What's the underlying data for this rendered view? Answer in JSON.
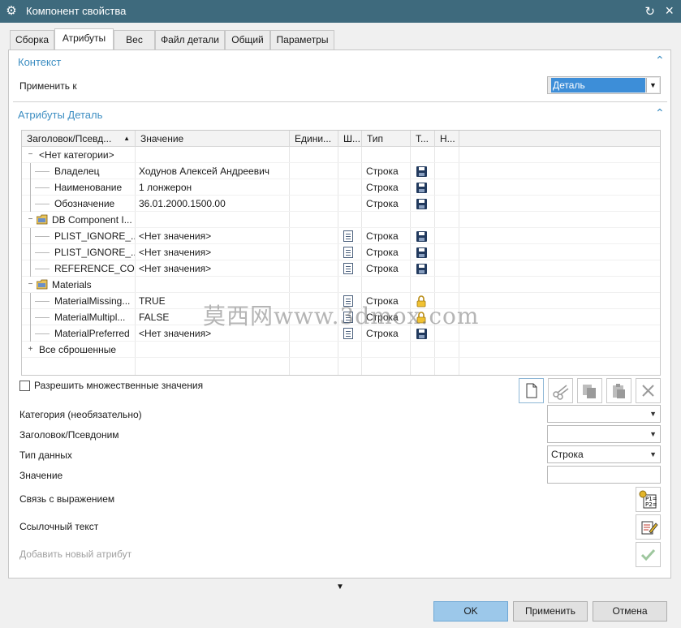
{
  "window": {
    "title": "Компонент свойства"
  },
  "tabs": [
    {
      "label": "Сборка"
    },
    {
      "label": "Атрибуты"
    },
    {
      "label": "Вес"
    },
    {
      "label": "Файл детали"
    },
    {
      "label": "Общий"
    },
    {
      "label": "Параметры"
    }
  ],
  "active_tab": "Атрибуты",
  "context": {
    "title": "Контекст",
    "apply_label": "Применить к",
    "apply_value": "Деталь"
  },
  "attributes": {
    "title": "Атрибуты Деталь",
    "columns": [
      "Заголовок/Псевд...",
      "Значение",
      "Едини...",
      "Ш...",
      "Тип",
      "Т...",
      "Н..."
    ],
    "rows": [
      {
        "title": "<Нет категории>",
        "value": "",
        "type": "",
        "kind": "category",
        "expand": "−",
        "icon": "none",
        "value_icon": false,
        "t_icon": "none",
        "depth": 0
      },
      {
        "title": "Владелец",
        "value": "Ходунов Алексей Андреевич",
        "type": "Строка",
        "kind": "item",
        "value_icon": false,
        "t_icon": "save-icon",
        "depth": 1
      },
      {
        "title": "Наименование",
        "value": "1 лонжерон",
        "type": "Строка",
        "kind": "item",
        "value_icon": false,
        "t_icon": "save-icon",
        "depth": 1
      },
      {
        "title": "Обозначение",
        "value": "36.01.2000.1500.00",
        "type": "Строка",
        "kind": "item",
        "value_icon": false,
        "t_icon": "save-icon",
        "depth": 1
      },
      {
        "title": "DB Component I...",
        "value": "",
        "type": "",
        "kind": "category",
        "expand": "−",
        "icon": "folder-icon",
        "value_icon": false,
        "t_icon": "none",
        "depth": 0
      },
      {
        "title": "PLIST_IGNORE_...",
        "value": "<Нет значения>",
        "type": "Строка",
        "kind": "item",
        "value_icon": true,
        "t_icon": "save-icon",
        "depth": 1
      },
      {
        "title": "PLIST_IGNORE_...",
        "value": "<Нет значения>",
        "type": "Строка",
        "kind": "item",
        "value_icon": true,
        "t_icon": "save-icon",
        "depth": 1
      },
      {
        "title": "REFERENCE_CO...",
        "value": "<Нет значения>",
        "type": "Строка",
        "kind": "item",
        "value_icon": true,
        "t_icon": "save-icon",
        "depth": 1
      },
      {
        "title": "Materials",
        "value": "",
        "type": "",
        "kind": "category",
        "expand": "−",
        "icon": "folder-icon",
        "value_icon": false,
        "t_icon": "none",
        "depth": 0
      },
      {
        "title": "MaterialMissing...",
        "value": "TRUE",
        "type": "Строка",
        "kind": "item",
        "value_icon": true,
        "t_icon": "lock-icon",
        "depth": 1
      },
      {
        "title": "MaterialMultipl...",
        "value": "FALSE",
        "type": "Строка",
        "kind": "item",
        "value_icon": true,
        "t_icon": "lock-icon",
        "depth": 1
      },
      {
        "title": "MaterialPreferred",
        "value": "<Нет значения>",
        "type": "Строка",
        "kind": "item",
        "value_icon": true,
        "t_icon": "save-icon",
        "depth": 1
      },
      {
        "title": "Все сброшенные",
        "value": "",
        "type": "",
        "kind": "category",
        "expand": "+",
        "icon": "none",
        "value_icon": false,
        "t_icon": "none",
        "depth": 0
      }
    ]
  },
  "multi": {
    "label": "Разрешить множественные значения",
    "checked": false
  },
  "form": {
    "category_label": "Категория (необязательно)",
    "category_value": "",
    "title_label": "Заголовок/Псевдоним",
    "title_value": "",
    "datatype_label": "Тип данных",
    "datatype_value": "Строка",
    "value_label": "Значение",
    "value_value": "",
    "expression_label": "Связь с выражением",
    "reftext_label": "Ссылочный текст",
    "add_label": "Добавить новый атрибут"
  },
  "buttons": {
    "ok": "OK",
    "apply": "Применить",
    "cancel": "Отмена"
  },
  "watermark": "莫西网www.3dmox.com",
  "colors": {
    "titlebar": "#3e6a7d",
    "accent": "#3d8ec2",
    "ok_button": "#9cc8ea"
  }
}
